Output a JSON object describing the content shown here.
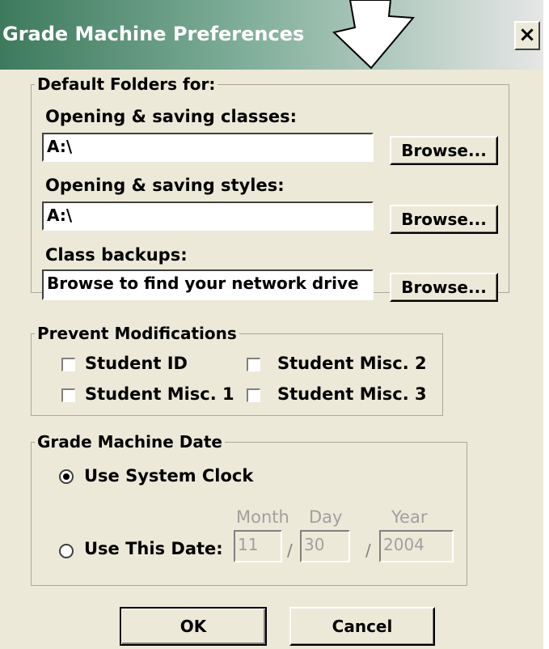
{
  "window": {
    "title": "Grade Machine Preferences",
    "close_label": "×"
  },
  "folders": {
    "group_label": "Default Folders for:",
    "classes": {
      "label": "Opening & saving classes:",
      "value": "A:\\",
      "button": "Browse..."
    },
    "styles": {
      "label": "Opening & saving styles:",
      "value": "A:\\",
      "button": "Browse..."
    },
    "backups": {
      "label": "Class backups:",
      "value": "Browse to find your network drive",
      "button": "Browse..."
    }
  },
  "prevent": {
    "group_label": "Prevent Modifications",
    "items": [
      {
        "label": "Student ID",
        "checked": false
      },
      {
        "label": "Student Misc. 2",
        "checked": false
      },
      {
        "label": "Student Misc. 1",
        "checked": false
      },
      {
        "label": "Student Misc. 3",
        "checked": false
      }
    ]
  },
  "date": {
    "group_label": "Grade Machine Date",
    "system_clock": "Use System Clock",
    "this_date": "Use This Date:",
    "month_label": "Month",
    "day_label": "Day",
    "year_label": "Year",
    "month": "11",
    "day": "30",
    "year": "2004",
    "separator": "/",
    "selected": "system_clock"
  },
  "buttons": {
    "ok": "OK",
    "cancel": "Cancel"
  },
  "colors": {
    "title_start": "#3d7a5c",
    "face": "#ece9d8",
    "disabled_text": "#a0a0a0"
  }
}
